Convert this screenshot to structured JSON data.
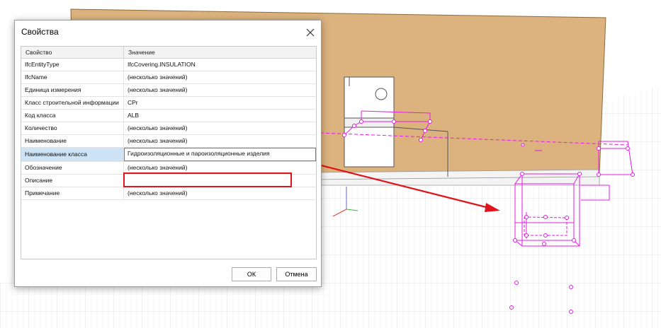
{
  "dialog": {
    "title": "Свойства",
    "columns": [
      "Свойство",
      "Значение"
    ],
    "rows": [
      {
        "property": "IfcEntityType",
        "value": "IfcCovering.INSULATION"
      },
      {
        "property": "IfcName",
        "value": "(несколько значений)"
      },
      {
        "property": "Единица измерения",
        "value": "(несколько значений)"
      },
      {
        "property": "Класс строительной информации",
        "value": "CPr"
      },
      {
        "property": "Код класса",
        "value": "ALB"
      },
      {
        "property": "Количество",
        "value": "(несколько значений)"
      },
      {
        "property": "Наименование",
        "value": "(несколько значений)"
      },
      {
        "property": "Наименование класса",
        "value": "Гидроизоляционные и пароизоляционные изделия"
      },
      {
        "property": "Обозначение",
        "value": "(несколько значений)"
      },
      {
        "property": "Описание",
        "value": ""
      },
      {
        "property": "Примечание",
        "value": "(несколько значений)"
      }
    ],
    "ok_label": "ОК",
    "cancel_label": "Отмена"
  },
  "colors": {
    "wall": "#dcb37e",
    "edges": "#e41ce4",
    "annotation": "#e0141c",
    "selection": "#cde4f7"
  },
  "icons": {
    "close": "close-icon",
    "axes": "axis-gizmo-icon"
  }
}
